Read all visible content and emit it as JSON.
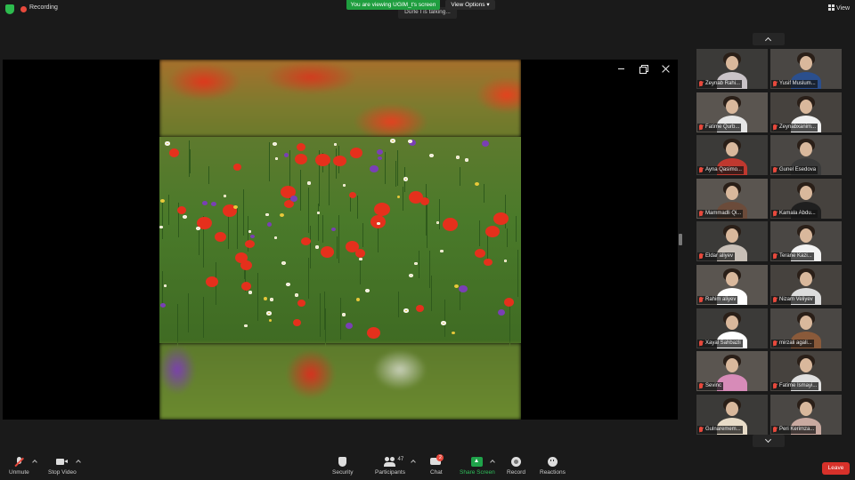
{
  "topbar": {
    "recording_label": "Recording",
    "viewing_banner": "You are viewing UGIM_t's screen",
    "view_options_label": "View Options",
    "talking_label": "Dürle I is talking...",
    "view_label": "View"
  },
  "share_window": {
    "content": "poppy meadow image",
    "controls": [
      "minimize-icon",
      "restore-icon",
      "close-icon"
    ]
  },
  "gallery": {
    "participants": [
      {
        "name": "Zeynab Rahi...",
        "muted": true,
        "shirt": "#c9c3c7"
      },
      {
        "name": "Yusif Muslum...",
        "muted": true,
        "shirt": "#2b4f8d"
      },
      {
        "name": "Fatime Qurb...",
        "muted": true,
        "shirt": "#e6e6e6"
      },
      {
        "name": "Zeynabxanim...",
        "muted": true,
        "shirt": "#f1f1f1"
      },
      {
        "name": "Ayna Qasimo...",
        "muted": true,
        "shirt": "#c0382f"
      },
      {
        "name": "Gunel Esedova",
        "muted": true,
        "shirt": "#3a3a3a"
      },
      {
        "name": "Mammadli Qi...",
        "muted": true,
        "shirt": "#6b4b3a"
      },
      {
        "name": "Kamala Abdu...",
        "muted": true,
        "shirt": "#1f1f1f"
      },
      {
        "name": "Eldar aliyev",
        "muted": true,
        "shirt": "#c8bfb7"
      },
      {
        "name": "Terane Kazi...",
        "muted": true,
        "shirt": "#f2f2f2"
      },
      {
        "name": "Rahim aliyev",
        "muted": true,
        "shirt": "#ffffff"
      },
      {
        "name": "Nizam Veliyev",
        "muted": true,
        "shirt": "#dcdcdc"
      },
      {
        "name": "Xayal Sahbazli",
        "muted": true,
        "shirt": "#ffffff"
      },
      {
        "name": "mirzali agali...",
        "muted": true,
        "shirt": "#8a5a3a"
      },
      {
        "name": "Sevinc",
        "muted": true,
        "shirt": "#d78bb8"
      },
      {
        "name": "Fatime Ismayi...",
        "muted": true,
        "shirt": "#e0e0e0"
      },
      {
        "name": "Gulnaremem...",
        "muted": true,
        "shirt": "#e8dcc8"
      },
      {
        "name": "Peri Kerimza...",
        "muted": true,
        "shirt": "#c9a9a0"
      }
    ]
  },
  "toolbar": {
    "unmute_label": "Unmute",
    "stop_video_label": "Stop Video",
    "security_label": "Security",
    "participants_label": "Participants",
    "participants_count": "47",
    "chat_label": "Chat",
    "chat_badge": "2",
    "share_screen_label": "Share Screen",
    "record_label": "Record",
    "reactions_label": "Reactions",
    "leave_label": "Leave"
  },
  "colors": {
    "background": "#1a1a1a",
    "viewing_banner": "#1f9e3f",
    "share_screen": "#1fa34a",
    "leave": "#d7312a",
    "muted": "#e8493c"
  }
}
